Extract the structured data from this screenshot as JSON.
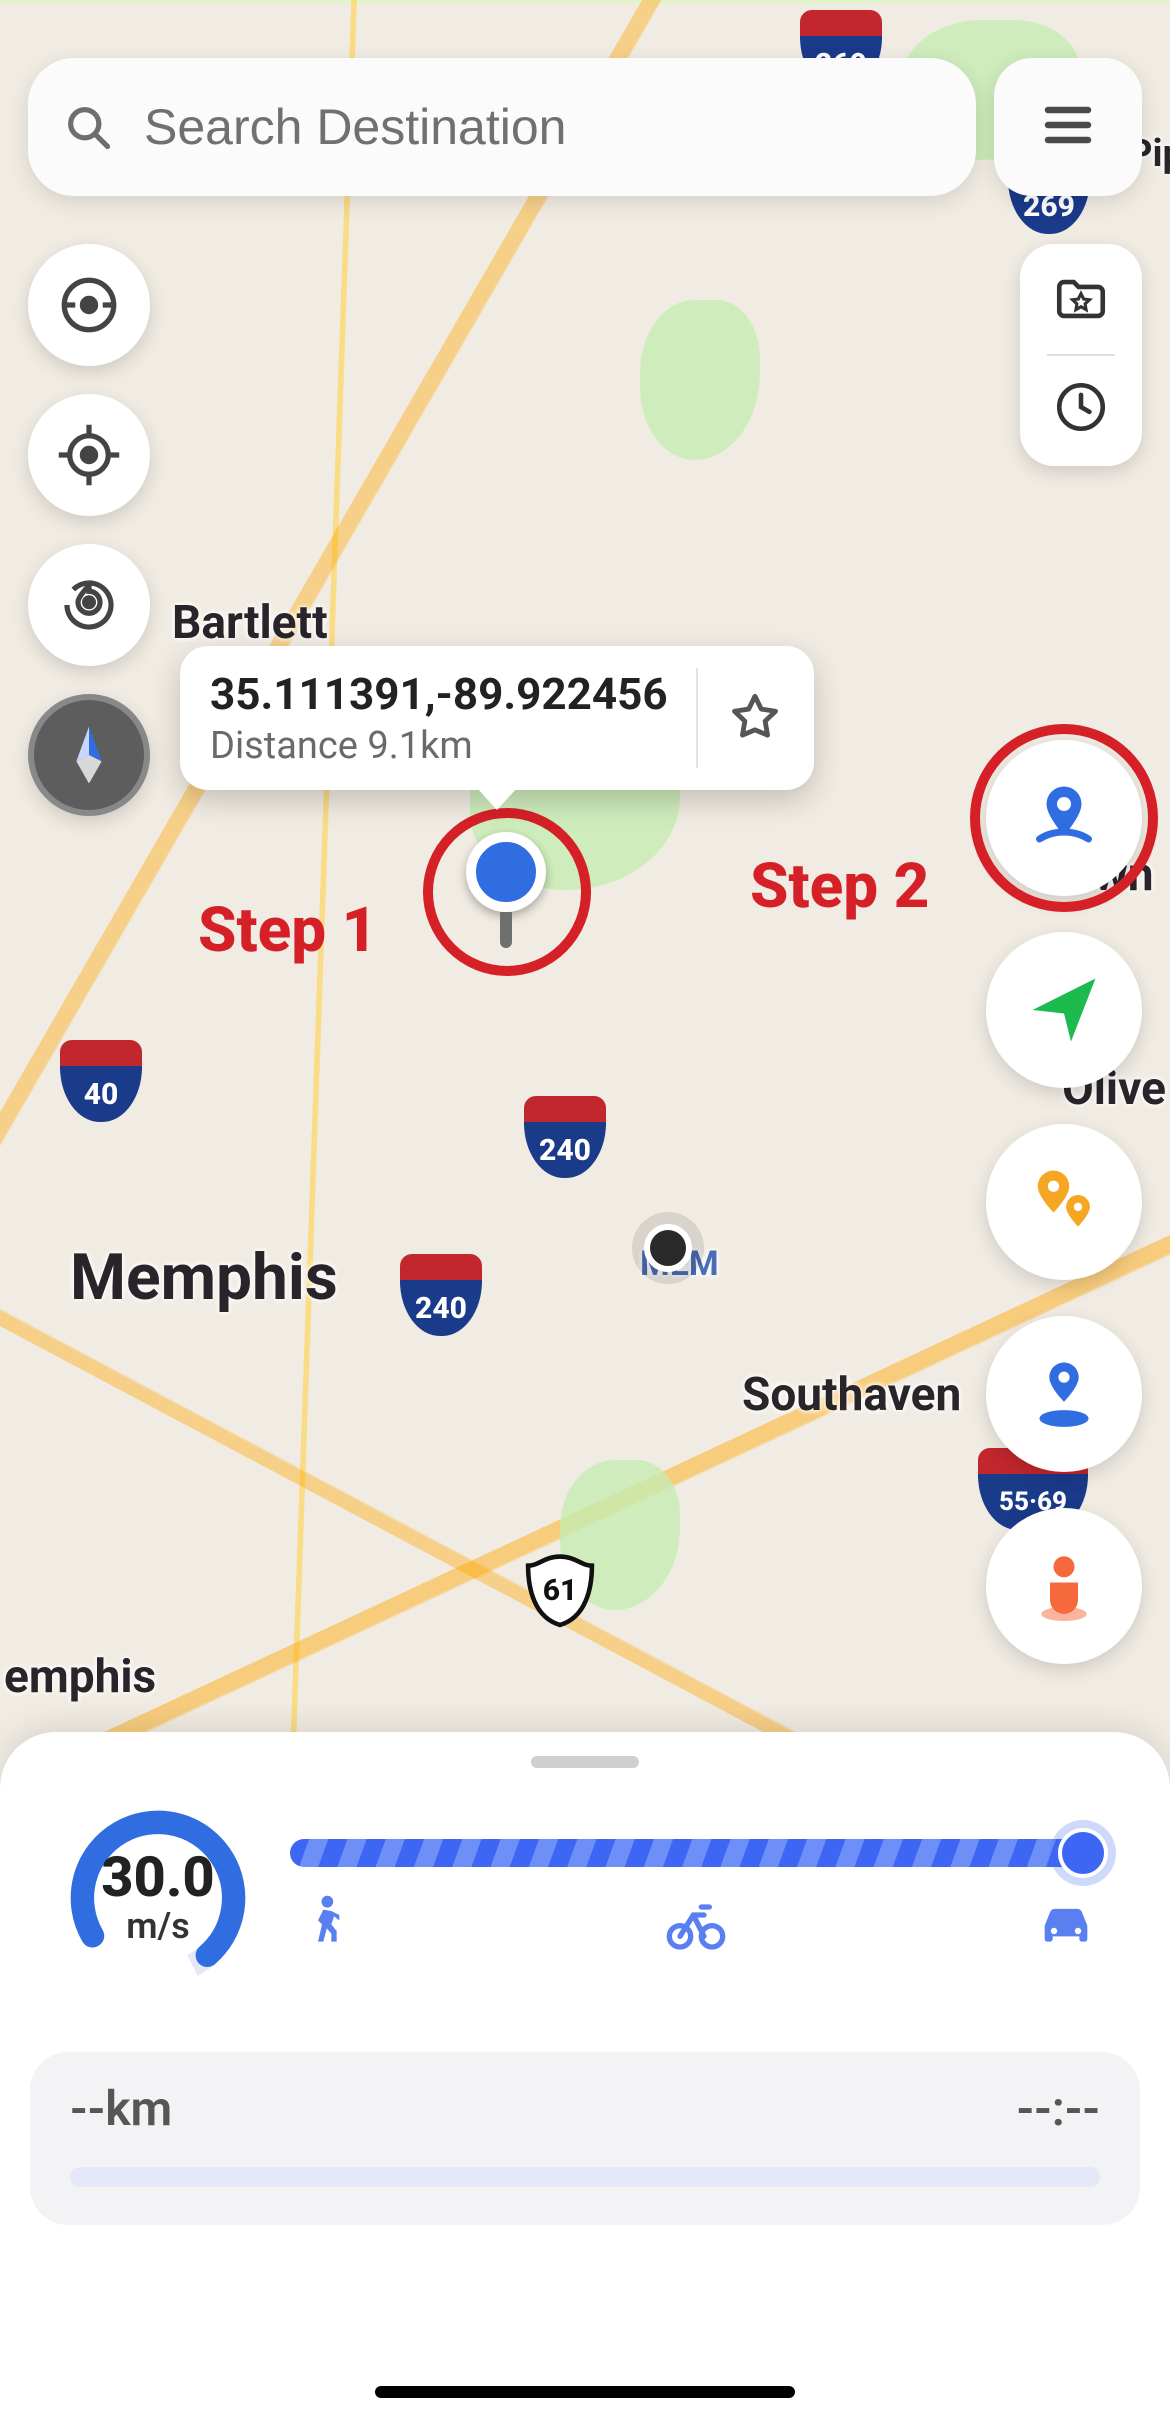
{
  "search": {
    "placeholder": "Search Destination"
  },
  "callout": {
    "coords": "35.111391,-89.922456",
    "distance_label": "Distance 9.1km"
  },
  "annotations": {
    "step1": "Step 1",
    "step2": "Step 2"
  },
  "map_labels": {
    "memphis": "Memphis",
    "emphis_partial": "emphis",
    "bartlett": "Bartlett",
    "germantown_partial": "wn",
    "southaven": "Southaven",
    "olive_partial": "Olive",
    "pip_partial": "Pip",
    "mem_airport": "MEM"
  },
  "shields": {
    "i269": "269",
    "i240_a": "240",
    "i240_b": "240",
    "i40": "40",
    "i55_69": "55·69",
    "us61": "61"
  },
  "speed": {
    "value": "30.0",
    "unit": "m/s"
  },
  "trip": {
    "distance": "--km",
    "time": "--:--"
  },
  "icons": {
    "search": "search-icon",
    "menu": "menu-icon",
    "target": "target-icon",
    "center": "center-location-icon",
    "rotate_pin": "rotate-pin-icon",
    "compass": "compass-icon",
    "fav_folder": "favorites-folder-icon",
    "history": "history-icon",
    "map_pin": "map-pin-icon",
    "send": "paper-plane-icon",
    "dual_pin": "dual-pin-icon",
    "pin_stand": "pin-stand-icon",
    "person": "person-spot-icon",
    "star": "star-icon",
    "walk": "walk-icon",
    "bike": "bike-icon",
    "car": "car-icon"
  }
}
